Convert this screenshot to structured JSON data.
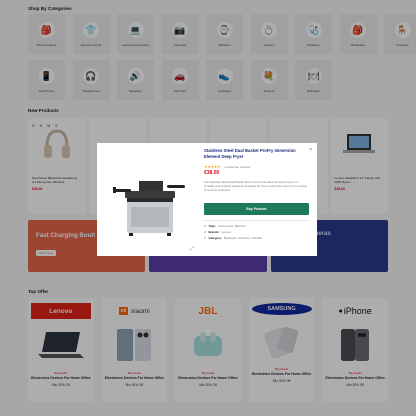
{
  "categories": {
    "title": "Shop By Categories",
    "items": [
      {
        "label": "Mens Clothing",
        "icon": "backpack-icon",
        "glyph": "🎒"
      },
      {
        "label": "Women's Cloth",
        "icon": "tshirt-icon",
        "glyph": "👕"
      },
      {
        "label": "Laptop & Computer",
        "icon": "laptop-icon",
        "glyph": "💻"
      },
      {
        "label": "Cameras",
        "icon": "camera-icon",
        "glyph": "📷"
      },
      {
        "label": "Watches",
        "icon": "watch-icon",
        "glyph": "⌚"
      },
      {
        "label": "Jewelry",
        "icon": "ring-icon",
        "glyph": "💍"
      },
      {
        "label": "Medicine",
        "icon": "stethoscope-icon",
        "glyph": "🩺"
      },
      {
        "label": "Backpack",
        "icon": "bag-icon",
        "glyph": "🎒"
      },
      {
        "label": "Furniture",
        "icon": "chair-icon",
        "glyph": "🪑"
      },
      {
        "label": "Cell Phone",
        "icon": "phone-icon",
        "glyph": "📱"
      },
      {
        "label": "Headphones",
        "icon": "headphones-icon",
        "glyph": "🎧"
      },
      {
        "label": "Speakers",
        "icon": "speaker-icon",
        "glyph": "🔊"
      },
      {
        "label": "Gift Toys",
        "icon": "toy-car-icon",
        "glyph": "🚗"
      },
      {
        "label": "Footwear",
        "icon": "shoe-icon",
        "glyph": "👟"
      },
      {
        "label": "Flowers",
        "icon": "flowers-icon",
        "glyph": "💐"
      },
      {
        "label": "Dishware",
        "icon": "dishware-icon",
        "glyph": "🍽"
      }
    ]
  },
  "new_products": {
    "title": "New Products",
    "items": [
      {
        "name": "Sennheiser Bluetooth Headphone 4.1 Momentum Wireless",
        "price": "€36.00",
        "countdown": "D H M S"
      },
      {
        "name": "",
        "price": ""
      },
      {
        "name": "",
        "price": ""
      },
      {
        "name": "",
        "price": ""
      },
      {
        "name": "",
        "price": ""
      },
      {
        "name": "Lenovo IdeaPad 3 14\" Laptop with AMD Ryzen",
        "price": "€48.00"
      }
    ]
  },
  "banners": {
    "left_title": "Fast Charging Boult Earbuds",
    "left_button": "Shop Now",
    "right_title": "Universal Cameras"
  },
  "top_offer": {
    "title": "Top Offer",
    "items": [
      {
        "brand": "Lenovo",
        "tag": "Big Deals",
        "name": "Electronics Devices For Home Office",
        "discount": "Min 30% Off"
      },
      {
        "brand": "xiaomi",
        "tag": "Big Deals",
        "name": "Electronics Devices For Home Office",
        "discount": "Min 30% Off"
      },
      {
        "brand": "JBL",
        "tag": "Big Deals",
        "name": "Electronics Devices For Home Office",
        "discount": "Min 30% Off"
      },
      {
        "brand": "SAMSUNG",
        "tag": "Big Deals",
        "name": "Electronics Devices For Home Office",
        "discount": "Min 30% Off"
      },
      {
        "brand": "iPhone",
        "tag": "Big Deals",
        "name": "Electronics Devices For Home Office",
        "discount": "Min 30% Off"
      }
    ]
  },
  "modal": {
    "title": "Stainless Steel Dual Basket ProFry Immersion Element Deep Fryer",
    "stars": "★★★★★",
    "rating_text": "0 customer reviews",
    "price": "€38.00",
    "description": "The Stainless Steel Dual Basket ProFry Immersion Element Deep Fryer is a versatile and powerful appliance designed for home cooks who want to fry a variety of foods to perfection.",
    "button": "Buy Product",
    "tags_label": "Tags:",
    "tags_value": "Instruments, Machine",
    "brands_label": "Brands:",
    "brands_value": "Lenovo",
    "category_label": "Category:",
    "category_value": "Backpack, Gift Items, SHOES",
    "close": "×",
    "zoom": "⤢"
  },
  "colors": {
    "accent": "#1f7a5a",
    "price": "#dd1122",
    "title": "#1a2a7a"
  }
}
